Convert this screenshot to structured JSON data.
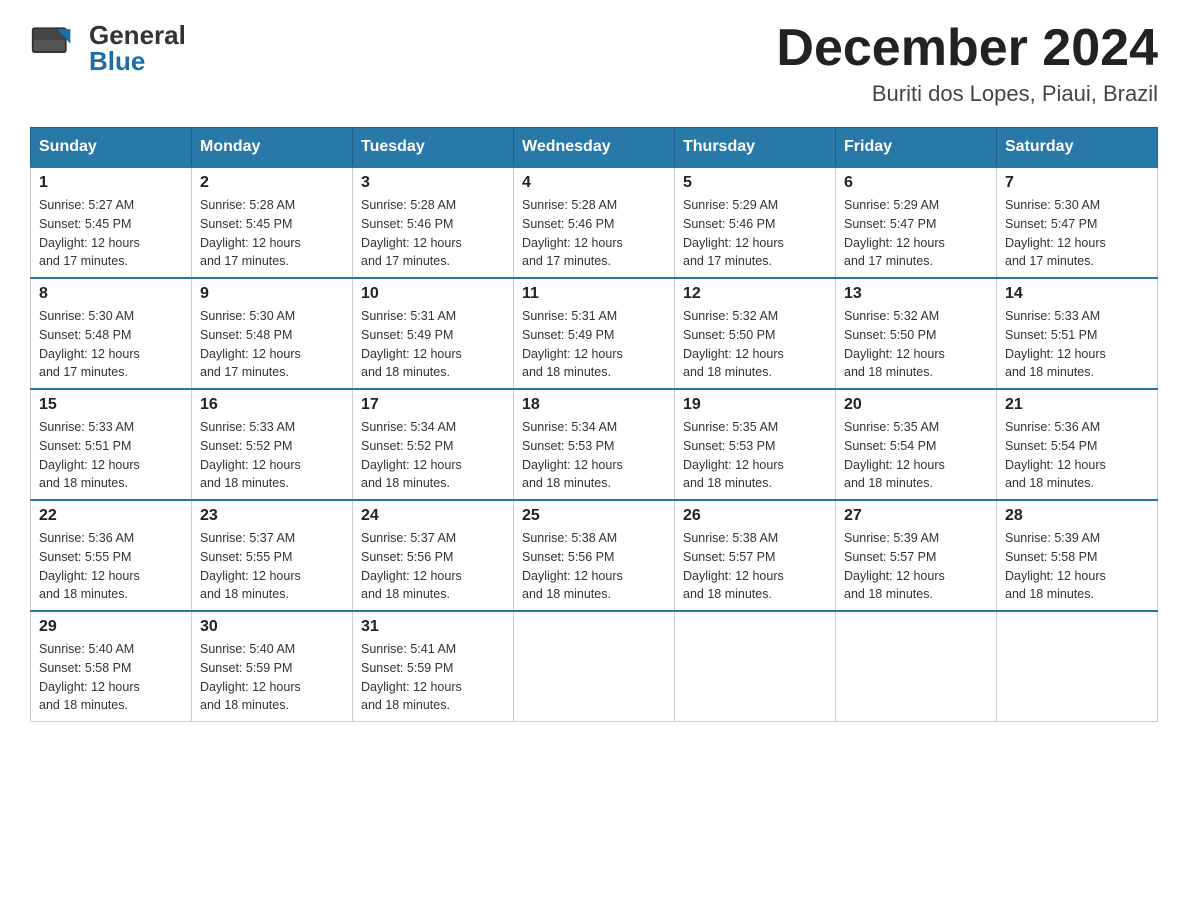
{
  "header": {
    "logo": {
      "general": "General",
      "blue": "Blue"
    },
    "title": "December 2024",
    "subtitle": "Buriti dos Lopes, Piaui, Brazil"
  },
  "calendar": {
    "days_of_week": [
      "Sunday",
      "Monday",
      "Tuesday",
      "Wednesday",
      "Thursday",
      "Friday",
      "Saturday"
    ],
    "weeks": [
      [
        {
          "day": "1",
          "sunrise": "5:27 AM",
          "sunset": "5:45 PM",
          "daylight": "12 hours and 17 minutes."
        },
        {
          "day": "2",
          "sunrise": "5:28 AM",
          "sunset": "5:45 PM",
          "daylight": "12 hours and 17 minutes."
        },
        {
          "day": "3",
          "sunrise": "5:28 AM",
          "sunset": "5:46 PM",
          "daylight": "12 hours and 17 minutes."
        },
        {
          "day": "4",
          "sunrise": "5:28 AM",
          "sunset": "5:46 PM",
          "daylight": "12 hours and 17 minutes."
        },
        {
          "day": "5",
          "sunrise": "5:29 AM",
          "sunset": "5:46 PM",
          "daylight": "12 hours and 17 minutes."
        },
        {
          "day": "6",
          "sunrise": "5:29 AM",
          "sunset": "5:47 PM",
          "daylight": "12 hours and 17 minutes."
        },
        {
          "day": "7",
          "sunrise": "5:30 AM",
          "sunset": "5:47 PM",
          "daylight": "12 hours and 17 minutes."
        }
      ],
      [
        {
          "day": "8",
          "sunrise": "5:30 AM",
          "sunset": "5:48 PM",
          "daylight": "12 hours and 17 minutes."
        },
        {
          "day": "9",
          "sunrise": "5:30 AM",
          "sunset": "5:48 PM",
          "daylight": "12 hours and 17 minutes."
        },
        {
          "day": "10",
          "sunrise": "5:31 AM",
          "sunset": "5:49 PM",
          "daylight": "12 hours and 18 minutes."
        },
        {
          "day": "11",
          "sunrise": "5:31 AM",
          "sunset": "5:49 PM",
          "daylight": "12 hours and 18 minutes."
        },
        {
          "day": "12",
          "sunrise": "5:32 AM",
          "sunset": "5:50 PM",
          "daylight": "12 hours and 18 minutes."
        },
        {
          "day": "13",
          "sunrise": "5:32 AM",
          "sunset": "5:50 PM",
          "daylight": "12 hours and 18 minutes."
        },
        {
          "day": "14",
          "sunrise": "5:33 AM",
          "sunset": "5:51 PM",
          "daylight": "12 hours and 18 minutes."
        }
      ],
      [
        {
          "day": "15",
          "sunrise": "5:33 AM",
          "sunset": "5:51 PM",
          "daylight": "12 hours and 18 minutes."
        },
        {
          "day": "16",
          "sunrise": "5:33 AM",
          "sunset": "5:52 PM",
          "daylight": "12 hours and 18 minutes."
        },
        {
          "day": "17",
          "sunrise": "5:34 AM",
          "sunset": "5:52 PM",
          "daylight": "12 hours and 18 minutes."
        },
        {
          "day": "18",
          "sunrise": "5:34 AM",
          "sunset": "5:53 PM",
          "daylight": "12 hours and 18 minutes."
        },
        {
          "day": "19",
          "sunrise": "5:35 AM",
          "sunset": "5:53 PM",
          "daylight": "12 hours and 18 minutes."
        },
        {
          "day": "20",
          "sunrise": "5:35 AM",
          "sunset": "5:54 PM",
          "daylight": "12 hours and 18 minutes."
        },
        {
          "day": "21",
          "sunrise": "5:36 AM",
          "sunset": "5:54 PM",
          "daylight": "12 hours and 18 minutes."
        }
      ],
      [
        {
          "day": "22",
          "sunrise": "5:36 AM",
          "sunset": "5:55 PM",
          "daylight": "12 hours and 18 minutes."
        },
        {
          "day": "23",
          "sunrise": "5:37 AM",
          "sunset": "5:55 PM",
          "daylight": "12 hours and 18 minutes."
        },
        {
          "day": "24",
          "sunrise": "5:37 AM",
          "sunset": "5:56 PM",
          "daylight": "12 hours and 18 minutes."
        },
        {
          "day": "25",
          "sunrise": "5:38 AM",
          "sunset": "5:56 PM",
          "daylight": "12 hours and 18 minutes."
        },
        {
          "day": "26",
          "sunrise": "5:38 AM",
          "sunset": "5:57 PM",
          "daylight": "12 hours and 18 minutes."
        },
        {
          "day": "27",
          "sunrise": "5:39 AM",
          "sunset": "5:57 PM",
          "daylight": "12 hours and 18 minutes."
        },
        {
          "day": "28",
          "sunrise": "5:39 AM",
          "sunset": "5:58 PM",
          "daylight": "12 hours and 18 minutes."
        }
      ],
      [
        {
          "day": "29",
          "sunrise": "5:40 AM",
          "sunset": "5:58 PM",
          "daylight": "12 hours and 18 minutes."
        },
        {
          "day": "30",
          "sunrise": "5:40 AM",
          "sunset": "5:59 PM",
          "daylight": "12 hours and 18 minutes."
        },
        {
          "day": "31",
          "sunrise": "5:41 AM",
          "sunset": "5:59 PM",
          "daylight": "12 hours and 18 minutes."
        },
        null,
        null,
        null,
        null
      ]
    ]
  }
}
